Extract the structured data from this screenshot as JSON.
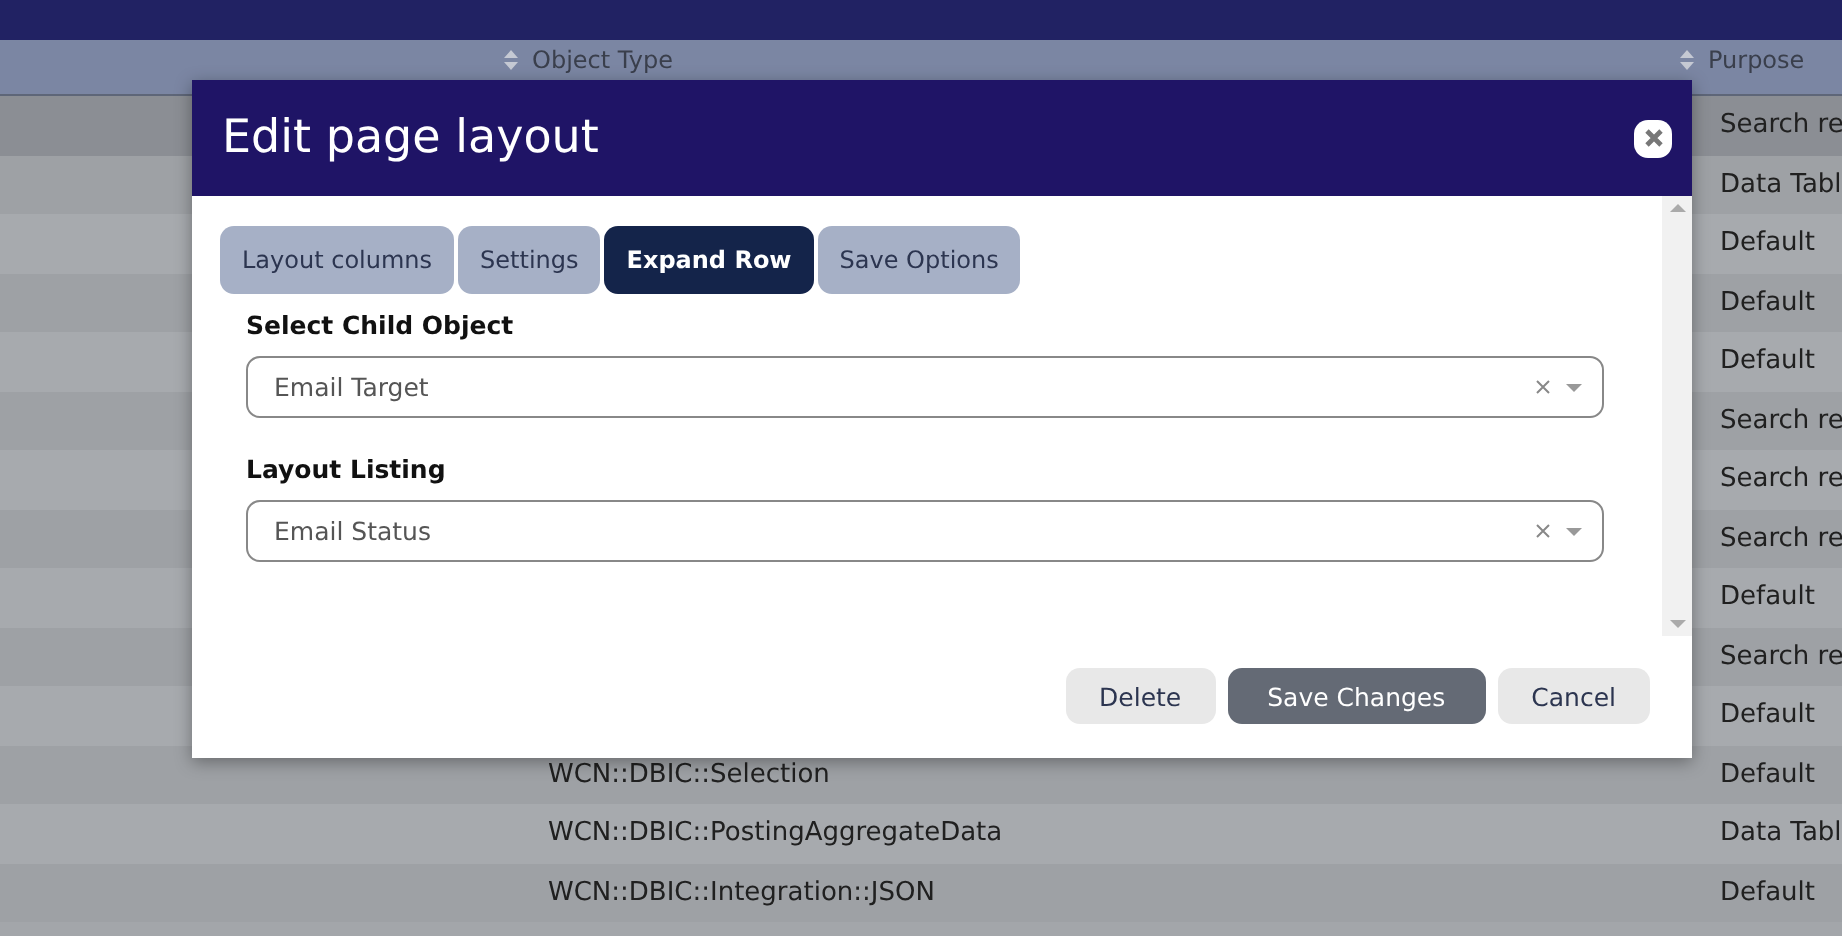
{
  "table": {
    "columns": [
      {
        "label": "Object Type",
        "sortable": true
      },
      {
        "label": "Purpose",
        "sortable": true
      }
    ],
    "rows": [
      {
        "purpose": "Search re",
        "selected": true
      },
      {
        "purpose": "Data Tabl",
        "selected": false
      },
      {
        "purpose": "Default",
        "selected": false
      },
      {
        "purpose": "Default",
        "selected": false
      },
      {
        "purpose": "Default",
        "selected": false
      },
      {
        "purpose": "Search re",
        "selected": false
      },
      {
        "purpose": "Search re",
        "selected": false
      },
      {
        "purpose": "Search re",
        "selected": false
      },
      {
        "purpose": "Default",
        "selected": false
      },
      {
        "purpose": "Search re",
        "selected": false
      },
      {
        "purpose": "Default",
        "selected": false
      },
      {
        "object_type": "WCN::DBIC::Selection",
        "purpose": "Default",
        "selected": false
      },
      {
        "object_type": "WCN::DBIC::PostingAggregateData",
        "purpose": "Data Tabl",
        "selected": false
      },
      {
        "object_type": "WCN::DBIC::Integration::JSON",
        "purpose": "Default",
        "selected": false
      }
    ]
  },
  "dialog": {
    "title": "Edit page layout",
    "tabs": [
      {
        "label": "Layout columns",
        "selected": false
      },
      {
        "label": "Settings",
        "selected": false
      },
      {
        "label": "Expand Row",
        "selected": true
      },
      {
        "label": "Save Options",
        "selected": false
      }
    ],
    "fields": [
      {
        "label": "Select Child Object",
        "value": "Email Target"
      },
      {
        "label": "Layout Listing",
        "value": "Email Status"
      }
    ],
    "buttons": [
      {
        "label": "Delete",
        "kind": "secondary"
      },
      {
        "label": "Save Changes",
        "kind": "primary"
      },
      {
        "label": "Cancel",
        "kind": "secondary"
      }
    ]
  }
}
